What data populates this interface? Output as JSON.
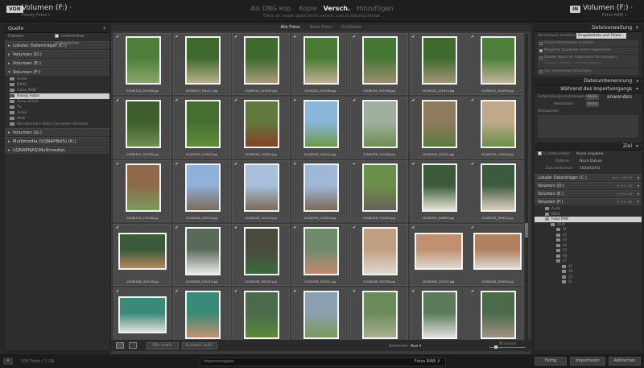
{
  "topbar": {
    "source": {
      "badge": "VON",
      "title": "Volumen (F:) ·",
      "sub": "Handy Fotos •"
    },
    "modes": [
      {
        "label": "Als DNG kop.",
        "active": false
      },
      {
        "label": "Kopie",
        "active": false
      },
      {
        "label": "Versch.",
        "active": true
      },
      {
        "label": "Hinzufügen",
        "active": false
      }
    ],
    "modes_sub": "Fotos an neuen Speicherort versch. und zu Katalog hinzuf.",
    "dest": {
      "badge": "IN",
      "title": "Volumen (F:) ·",
      "sub": "Fotos RAW •"
    }
  },
  "left": {
    "header": "Quelle",
    "dateien": "Dateien",
    "subfolders_label": "Unterordner einbeziehen",
    "volumes": [
      {
        "label": "Lokaler Datenträger (C:)",
        "open": false
      },
      {
        "label": "Volumen (D:)",
        "open": false
      },
      {
        "label": "Volumen (E:)",
        "open": false
      },
      {
        "label": "Volumen (F:)",
        "open": true
      }
    ],
    "folders": [
      {
        "label": "Audio",
        "selected": false
      },
      {
        "label": "DIKIS",
        "selected": false
      },
      {
        "label": "Fotos RAW",
        "selected": false
      },
      {
        "label": "Handy Fotos",
        "selected": true
      },
      {
        "label": "Sony a6100",
        "selected": false
      },
      {
        "label": "TV",
        "selected": false
      },
      {
        "label": "Video",
        "selected": false
      },
      {
        "label": "Walk",
        "selected": false
      },
      {
        "label": "Wondershare Video Converter Ultimate",
        "selected": false
      }
    ],
    "volumes_after": [
      {
        "label": "Volumen (G:)"
      },
      {
        "label": "Multimedia (\\\\QNAPNAS) (K:)"
      },
      {
        "label": "\\\\QNAPNAS\\Multimedia\\"
      }
    ]
  },
  "center": {
    "tabs": [
      {
        "label": "Alle Fotos",
        "active": true
      },
      {
        "label": "Neue Fotos",
        "active": false
      },
      {
        "label": "Dubletten",
        "active": false
      }
    ],
    "thumbnails": [
      {
        "file": "20180322_101409.jpg",
        "colors": [
          "#4d7f3a",
          "#8aa76a"
        ],
        "checked": true
      },
      {
        "file": "20180322_101417.jpg",
        "colors": [
          "#3f6a2e",
          "#b9b08a"
        ],
        "checked": true
      },
      {
        "file": "20180322_101425.jpg",
        "colors": [
          "#3f6a2e",
          "#aa9a7a"
        ],
        "checked": true
      },
      {
        "file": "20180322_101436.jpg",
        "colors": [
          "#4a7a35",
          "#c0b090"
        ],
        "checked": true
      },
      {
        "file": "20180322_101508.jpg",
        "colors": [
          "#467835",
          "#9b8e6e"
        ],
        "checked": true
      },
      {
        "file": "20180322_101613.jpg",
        "colors": [
          "#3f6a2e",
          "#a39578"
        ],
        "checked": true
      },
      {
        "file": "20180322_101650.jpg",
        "colors": [
          "#4d7f3a",
          "#c2b49a"
        ],
        "checked": true
      },
      {
        "file": "20180322_101705.jpg",
        "colors": [
          "#3c5f2b",
          "#6e8f4e"
        ],
        "checked": true
      },
      {
        "file": "20180326_110005.jpg",
        "colors": [
          "#466e32",
          "#5f8d3c"
        ],
        "checked": true
      },
      {
        "file": "20180326_110015.jpg",
        "colors": [
          "#5f7a3c",
          "#8a3f2a"
        ],
        "checked": true
      },
      {
        "file": "20180326_110024.jpg",
        "colors": [
          "#8bb6dc",
          "#6a9a4a"
        ],
        "checked": true
      },
      {
        "file": "20180326_110046.jpg",
        "colors": [
          "#9fb0a0",
          "#6e8c52"
        ],
        "checked": true
      },
      {
        "file": "20180326_110101.jpg",
        "colors": [
          "#8f7a5e",
          "#5a7a3e"
        ],
        "checked": true
      },
      {
        "file": "20180326_110204.jpg",
        "colors": [
          "#bfa98a",
          "#6a8f4a"
        ],
        "checked": true
      },
      {
        "file": "20180326_110258.jpg",
        "colors": [
          "#8f6a4a",
          "#7a9a5a"
        ],
        "checked": true
      },
      {
        "file": "20180326_110316.jpg",
        "colors": [
          "#8fb0d8",
          "#7a6a5a"
        ],
        "checked": true
      },
      {
        "file": "20180326_110333.jpg",
        "colors": [
          "#a8c0dc",
          "#7a6a58"
        ],
        "checked": true
      },
      {
        "file": "20180326_110354.jpg",
        "colors": [
          "#a0b8d8",
          "#7a6a58"
        ],
        "checked": true
      },
      {
        "file": "20180326_110402.jpg",
        "colors": [
          "#6a8f4a",
          "#6a6058"
        ],
        "checked": true
      },
      {
        "file": "20180330_165603.jpg",
        "colors": [
          "#3a5a3a",
          "#e8e2d8"
        ],
        "checked": true
      },
      {
        "file": "20180330_165612.jpg",
        "colors": [
          "#3e5a3e",
          "#dcd0c0"
        ],
        "checked": true
      },
      {
        "file": "20180408_100118.jpg",
        "colors": [
          "#3a5a3a",
          "#b08a60"
        ],
        "checked": true
      },
      {
        "file": "20180408_100143.jpg",
        "colors": [
          "#5a6a5a",
          "#e8e8e8"
        ],
        "checked": true
      },
      {
        "file": "20180408_100151.jpg",
        "colors": [
          "#4a4a3e",
          "#3a6a3a"
        ],
        "checked": true
      },
      {
        "file": "20180408_100251.jpg",
        "colors": [
          "#6f8a6a",
          "#c08a70"
        ],
        "checked": true
      },
      {
        "file": "20180408_100328.jpg",
        "colors": [
          "#c0a080",
          "#e0d8d0"
        ],
        "checked": true
      },
      {
        "file": "20180408_100352.jpg",
        "colors": [
          "#c09070",
          "#e0d8d0"
        ],
        "checked": true
      },
      {
        "file": "20180408_100403.jpg",
        "colors": [
          "#b08060",
          "#e0d8d0"
        ],
        "checked": true
      },
      {
        "file": "20180408_101104.jpg",
        "colors": [
          "#3a8a7a",
          "#e0e0d8"
        ],
        "checked": true
      },
      {
        "file": "20180408_101113.jpg",
        "colors": [
          "#3a8a7a",
          "#c09070"
        ],
        "checked": true
      },
      {
        "file": "20180408_101117.jpg",
        "colors": [
          "#4a6a4a",
          "#5a8a3a"
        ],
        "checked": true
      },
      {
        "file": "20180408_101126.jpg",
        "colors": [
          "#8aa0b0",
          "#7a9a5a"
        ],
        "checked": true
      },
      {
        "file": "20180408_101134.jpg",
        "colors": [
          "#6a8a5a",
          "#aab090"
        ],
        "checked": true
      },
      {
        "file": "20180408_101138.jpg",
        "colors": [
          "#5a7a5a",
          "#e0e0e0"
        ],
        "checked": true
      },
      {
        "file": "20180408_101146.jpg",
        "colors": [
          "#4a6a4a",
          "#a09080"
        ],
        "checked": true
      }
    ]
  },
  "gridtoolbar": {
    "select_all": "Alle mark.",
    "deselect_all": "Auswahl aufh.",
    "sort_label": "Sortieren:",
    "sort_value": "Aus ▾",
    "thumbnails_label": "Miniaturen"
  },
  "right": {
    "file_handling_header": "Dateiverwaltung",
    "previews_label": "Vorschauen erstellen:",
    "previews_value": "Eingebettete und Filiald...",
    "smart_previews": "Smart-Vorschauen erstellen",
    "no_dupes": "Mögliche Duplikate nicht importieren",
    "second_copy": "Zweite Kopie an folgendem Ort anlegen:",
    "second_copy_path": "F:\\Users\\...\\Pictures\\...\\Download Backups",
    "add_collection": "Zur Sammlung hinzufügen",
    "rename_header": "Dateiumbenennung",
    "apply_header": "Während des Importvorgangs anwenden",
    "develop_label": "Entwicklungseinstellungen:",
    "develop_value": "Keine",
    "metadata_label": "Metadaten:",
    "metadata_value": "Keine",
    "keywords_label": "Stichwörter:",
    "dest_header": "Ziel",
    "into_subfolder": "In Unterordner",
    "into_subfolder_value": "Keine angaben",
    "organize_label": "Ordnen:",
    "organize_value": "Nach Datum",
    "dateformat_label": "Datumsformat:",
    "dateformat_value": "2020/02/01",
    "volumes": [
      {
        "label": "Lokaler Datenträger (C:)",
        "size": "9/41 / 199 GB"
      },
      {
        "label": "Volumen (D:)",
        "size": "8 / 931 GB"
      },
      {
        "label": "Volumen (E:)",
        "size": "8 / 931 GB"
      },
      {
        "label": "Volumen (F:)",
        "size": "8 / 931 GB"
      }
    ],
    "folders": [
      {
        "label": "Audio",
        "indent": 1,
        "selected": false
      },
      {
        "label": "DIKIS",
        "indent": 1,
        "selected": false
      },
      {
        "label": "Fotos RAW",
        "indent": 1,
        "selected": true
      },
      {
        "label": "2019",
        "indent": 2,
        "selected": false
      },
      {
        "label": "01",
        "indent": 3,
        "selected": false
      },
      {
        "label": "02",
        "indent": 3,
        "selected": false
      },
      {
        "label": "03",
        "indent": 3,
        "selected": false
      },
      {
        "label": "04",
        "indent": 3,
        "selected": false
      },
      {
        "label": "05",
        "indent": 3,
        "selected": false
      },
      {
        "label": "06",
        "indent": 3,
        "selected": false
      },
      {
        "label": "07",
        "indent": 3,
        "selected": false
      },
      {
        "label": "01",
        "indent": 4,
        "selected": false
      },
      {
        "label": "18",
        "indent": 4,
        "selected": false
      },
      {
        "label": "20",
        "indent": 4,
        "selected": false
      },
      {
        "label": "21",
        "indent": 4,
        "selected": false
      }
    ]
  },
  "bottombar": {
    "count": "105 Fotos / 1 GB",
    "preset_label": "Importvorgabe:",
    "preset_value": "Fotos RAW ↕",
    "done": "Fertig",
    "import": "Importieren",
    "cancel": "Abbrechen"
  }
}
